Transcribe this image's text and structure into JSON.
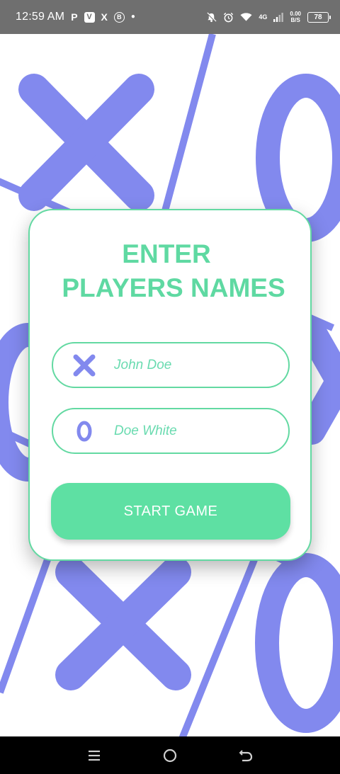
{
  "status_bar": {
    "time": "12:59 AM",
    "notification_icons": [
      "P",
      "V",
      "X",
      "B"
    ],
    "network": "4G",
    "speed_top": "0.00",
    "speed_bottom": "B/S",
    "battery": "78"
  },
  "card": {
    "title_line1": "ENTER",
    "title_line2": "PLAYERS NAMES",
    "player_x": {
      "icon": "x-mark-icon",
      "placeholder": "John Doe"
    },
    "player_o": {
      "icon": "o-mark-icon",
      "placeholder": "Doe White"
    },
    "start_button_label": "START GAME"
  },
  "colors": {
    "accent_green": "#5ee0a3",
    "mark_purple": "#8289ee",
    "status_bar_bg": "#6f6f6f"
  },
  "nav_bar": {
    "icons": [
      "recents-icon",
      "home-icon",
      "back-icon"
    ]
  }
}
